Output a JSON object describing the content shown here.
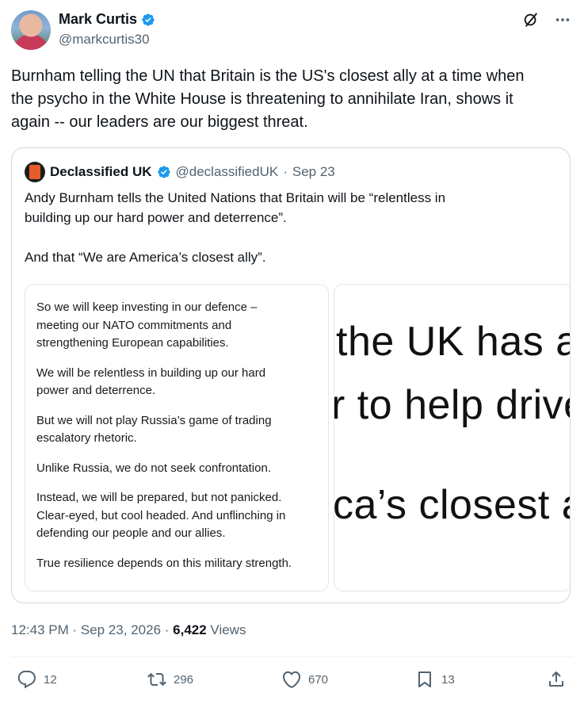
{
  "author": {
    "name": "Mark Curtis",
    "handle": "@markcurtis30"
  },
  "tweet": {
    "text": "Burnham telling the UN that Britain is the US's closest ally at a time when\nthe psycho in the White House is threatening to annihilate Iran, shows it\nagain -- our leaders are our biggest threat."
  },
  "quote": {
    "name": "Declassified UK",
    "handle": "@declassifiedUK",
    "date": "Sep 23",
    "text": "Andy Burnham tells the United Nations that Britain will be “relentless in\nbuilding up our hard power and deterrence”.\n\nAnd that “We are America’s closest ally”.",
    "image1_paragraphs": [
      "So we will keep investing in our defence –\nmeeting our NATO commitments and\nstrengthening European capabilities.",
      "We will be relentless in building up our hard\npower and deterrence.",
      "But we will not play Russia’s game of trading\nescalatory rhetoric.",
      "Unlike Russia, we do not seek confrontation.",
      "Instead, we will be prepared, but not panicked.\nClear-eyed, but cool headed. And unflinching in\ndefending our people and our allies.",
      "True resilience depends on this military strength."
    ],
    "image2_lines": [
      "the UK has a",
      "r to help drive",
      "ca’s closest a"
    ]
  },
  "meta": {
    "time": "12:43 PM",
    "date": "Sep 23, 2026",
    "views_count": "6,422",
    "views_label": "Views"
  },
  "actions": {
    "replies": "12",
    "reposts": "296",
    "likes": "670",
    "bookmarks": "13"
  },
  "colors": {
    "verified": "#1d9bf0",
    "secondary_text": "#536471",
    "border": "#cfd9de"
  },
  "icons": [
    "verified-badge-icon",
    "grok-icon",
    "more-icon",
    "reply-icon",
    "repost-icon",
    "like-icon",
    "bookmark-icon",
    "share-icon"
  ]
}
